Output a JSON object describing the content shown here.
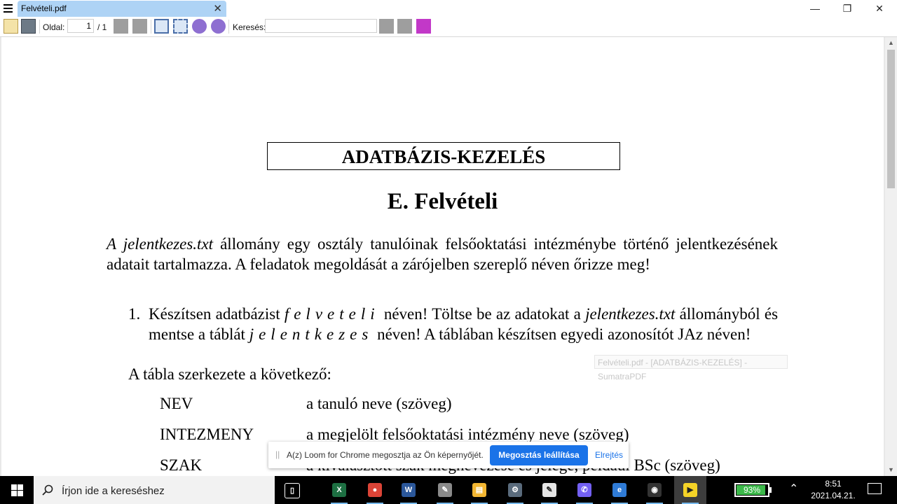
{
  "window": {
    "tab_title": "Felvételi.pdf",
    "close_tab_glyph": "✕",
    "controls": {
      "minimize": "—",
      "restore": "❐",
      "close": "✕"
    }
  },
  "toolbar": {
    "page_label": "Oldal:",
    "page_current": "1",
    "page_total": "/ 1",
    "search_label": "Keresés:",
    "search_value": "",
    "icons": [
      "open-icon",
      "print-icon",
      "prev-page-icon",
      "next-page-icon",
      "fit-page-icon",
      "fit-width-icon",
      "zoom-out-icon",
      "zoom-in-icon",
      "find-prev-icon",
      "find-next-icon",
      "match-case-icon"
    ]
  },
  "document": {
    "heading_box": "ADATBÁZIS-KEZELÉS",
    "subtitle": "E. Felvételi",
    "intro_italic": "A jelentkezes.txt",
    "intro_rest": " állomány egy osztály tanulóinak felsőoktatási intézménybe történő jelentkezésének adatait tartalmazza. A feladatok megoldását a zárójelben szereplő néven őrizze meg!",
    "item1_num": "1.",
    "item1_a": "Készítsen adatbázist ",
    "item1_db": "felveteli",
    "item1_b": " néven! Töltse be az adatokat a ",
    "item1_file": "jelentkezes.txt",
    "item1_c": " állományból és mentse a táblát ",
    "item1_table": "jelentkezes",
    "item1_d": " néven! A táblában készítsen egyedi azonosítót JAz néven!",
    "table_intro": "A tábla szerkezete a következő:",
    "fields": [
      {
        "name": "NEV",
        "desc": "a tanuló neve (szöveg)"
      },
      {
        "name": "INTEZMENY",
        "desc": "a megjelölt felsőoktatási intézmény neve (szöveg)"
      },
      {
        "name": "SZAK",
        "desc": "a kiválasztott szak megnevezése és jelege, például BSc (szöveg)"
      }
    ],
    "ghost_tooltip": "Felvételi.pdf - [ADATBÁZIS-KEZELÉS] - SumatraPDF"
  },
  "loom": {
    "grip": "||",
    "message": "A(z) Loom for Chrome megosztja az Ön képernyőjét.",
    "stop_label": "Megosztás leállítása",
    "hide_label": "Elrejtés"
  },
  "taskbar": {
    "search_placeholder": "Írjon ide a kereséshez",
    "apps": [
      {
        "name": "task-view",
        "glyph": "▯",
        "color": "#000000"
      },
      {
        "name": "excel",
        "glyph": "X",
        "color": "#1d6f42"
      },
      {
        "name": "chrome",
        "glyph": "●",
        "color": "#db4437"
      },
      {
        "name": "word",
        "glyph": "W",
        "color": "#2b579a"
      },
      {
        "name": "paint",
        "glyph": "✎",
        "color": "#8a8a8a"
      },
      {
        "name": "file-explorer",
        "glyph": "▤",
        "color": "#f2b632"
      },
      {
        "name": "settings-app",
        "glyph": "⚙",
        "color": "#5a6b7c"
      },
      {
        "name": "notepad",
        "glyph": "✎",
        "color": "#e5e5e5"
      },
      {
        "name": "viber",
        "glyph": "✆",
        "color": "#7360f2"
      },
      {
        "name": "edge",
        "glyph": "e",
        "color": "#2f7bd6"
      },
      {
        "name": "camera-app",
        "glyph": "◉",
        "color": "#333333"
      },
      {
        "name": "sumatrapdf",
        "glyph": "▶",
        "color": "#f5d327"
      }
    ],
    "battery_percent": 93,
    "battery_text": "93%",
    "time": "8:51",
    "date": "2021.04.21."
  },
  "colors": {
    "tab_active": "#aed3f5",
    "loom_accent": "#1a73e8",
    "battery_green": "#3cb94a"
  }
}
